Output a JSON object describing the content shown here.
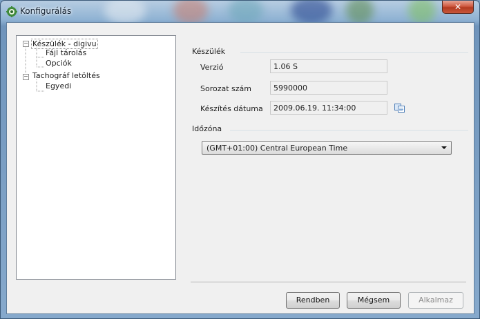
{
  "window": {
    "title": "Konfigurálás",
    "close_glyph": "✕",
    "icon": "gear-app-icon"
  },
  "tree": {
    "items": [
      {
        "label": "Készülék - digivu",
        "expander": "−",
        "selected": true
      },
      {
        "label": "Fájl tárolás"
      },
      {
        "label": "Opciók"
      },
      {
        "label": "Tachográf letöltés",
        "expander": "−"
      },
      {
        "label": "Egyedi"
      }
    ]
  },
  "device_group": {
    "legend": "Készülék",
    "version_label": "Verzió",
    "version_value": "1.06 S",
    "serial_label": "Sorozat szám",
    "serial_value": "5990000",
    "date_label": "Készítés dátuma",
    "date_value": "2009.06.19. 11:34:00",
    "copy_icon": "copy-icon"
  },
  "timezone_group": {
    "legend": "Időzóna",
    "selected": "(GMT+01:00) Central European Time"
  },
  "buttons": {
    "ok": "Rendben",
    "cancel": "Mégsem",
    "apply": "Alkalmaz"
  },
  "colors": {
    "window_frame": "#86a9cc",
    "close_button": "#c8583c",
    "client_bg": "#f0f0f0"
  }
}
